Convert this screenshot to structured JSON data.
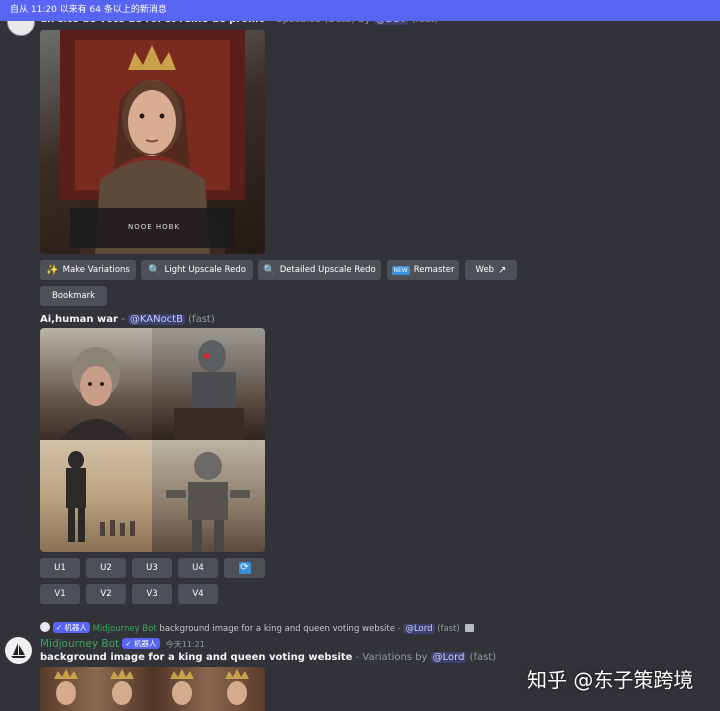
{
  "banner": {
    "text": "自从 11:20 以来有 64 条以上的新消息"
  },
  "message1": {
    "title_fragment": "un site de vote de roi et reine de promo",
    "suffix": " - Upscaled (Beta) by ",
    "mention": "@DaV",
    "speed": " (fast)",
    "image_text": "NOOE  HOBK",
    "buttons": {
      "make_variations": "Make Variations",
      "light_upscale_redo": "Light Upscale Redo",
      "detailed_upscale_redo": "Detailed Upscale Redo",
      "remaster": "Remaster",
      "remaster_badge": "NEW",
      "web": "Web",
      "bookmark": "Bookmark"
    }
  },
  "message2": {
    "prompt": "Ai,human war",
    "dash": " - ",
    "mention": "@KANoctB",
    "speed": " (fast)",
    "upscale_buttons": [
      "U1",
      "U2",
      "U3",
      "U4"
    ],
    "variation_buttons": [
      "V1",
      "V2",
      "V3",
      "V4"
    ]
  },
  "reply": {
    "badge": "✓ 机器人",
    "author": "Midjourney Bot",
    "prompt": "background image for a king and queen voting website",
    "dash": " - ",
    "mention": "@Lord",
    "speed": " (fast)"
  },
  "message3": {
    "author": "Midjourney Bot",
    "badge": "✓ 机器人",
    "timestamp": "今天11:21",
    "prompt": "background image for a king and queen voting website",
    "suffix": " - Variations by ",
    "mention": "@Lord",
    "speed": " (fast)"
  },
  "watermark": {
    "text": "知乎 @东子策跨境"
  },
  "colors": {
    "banner": "#5865f2",
    "background": "#313338",
    "button": "#4e5058",
    "author": "#3ba55d"
  }
}
